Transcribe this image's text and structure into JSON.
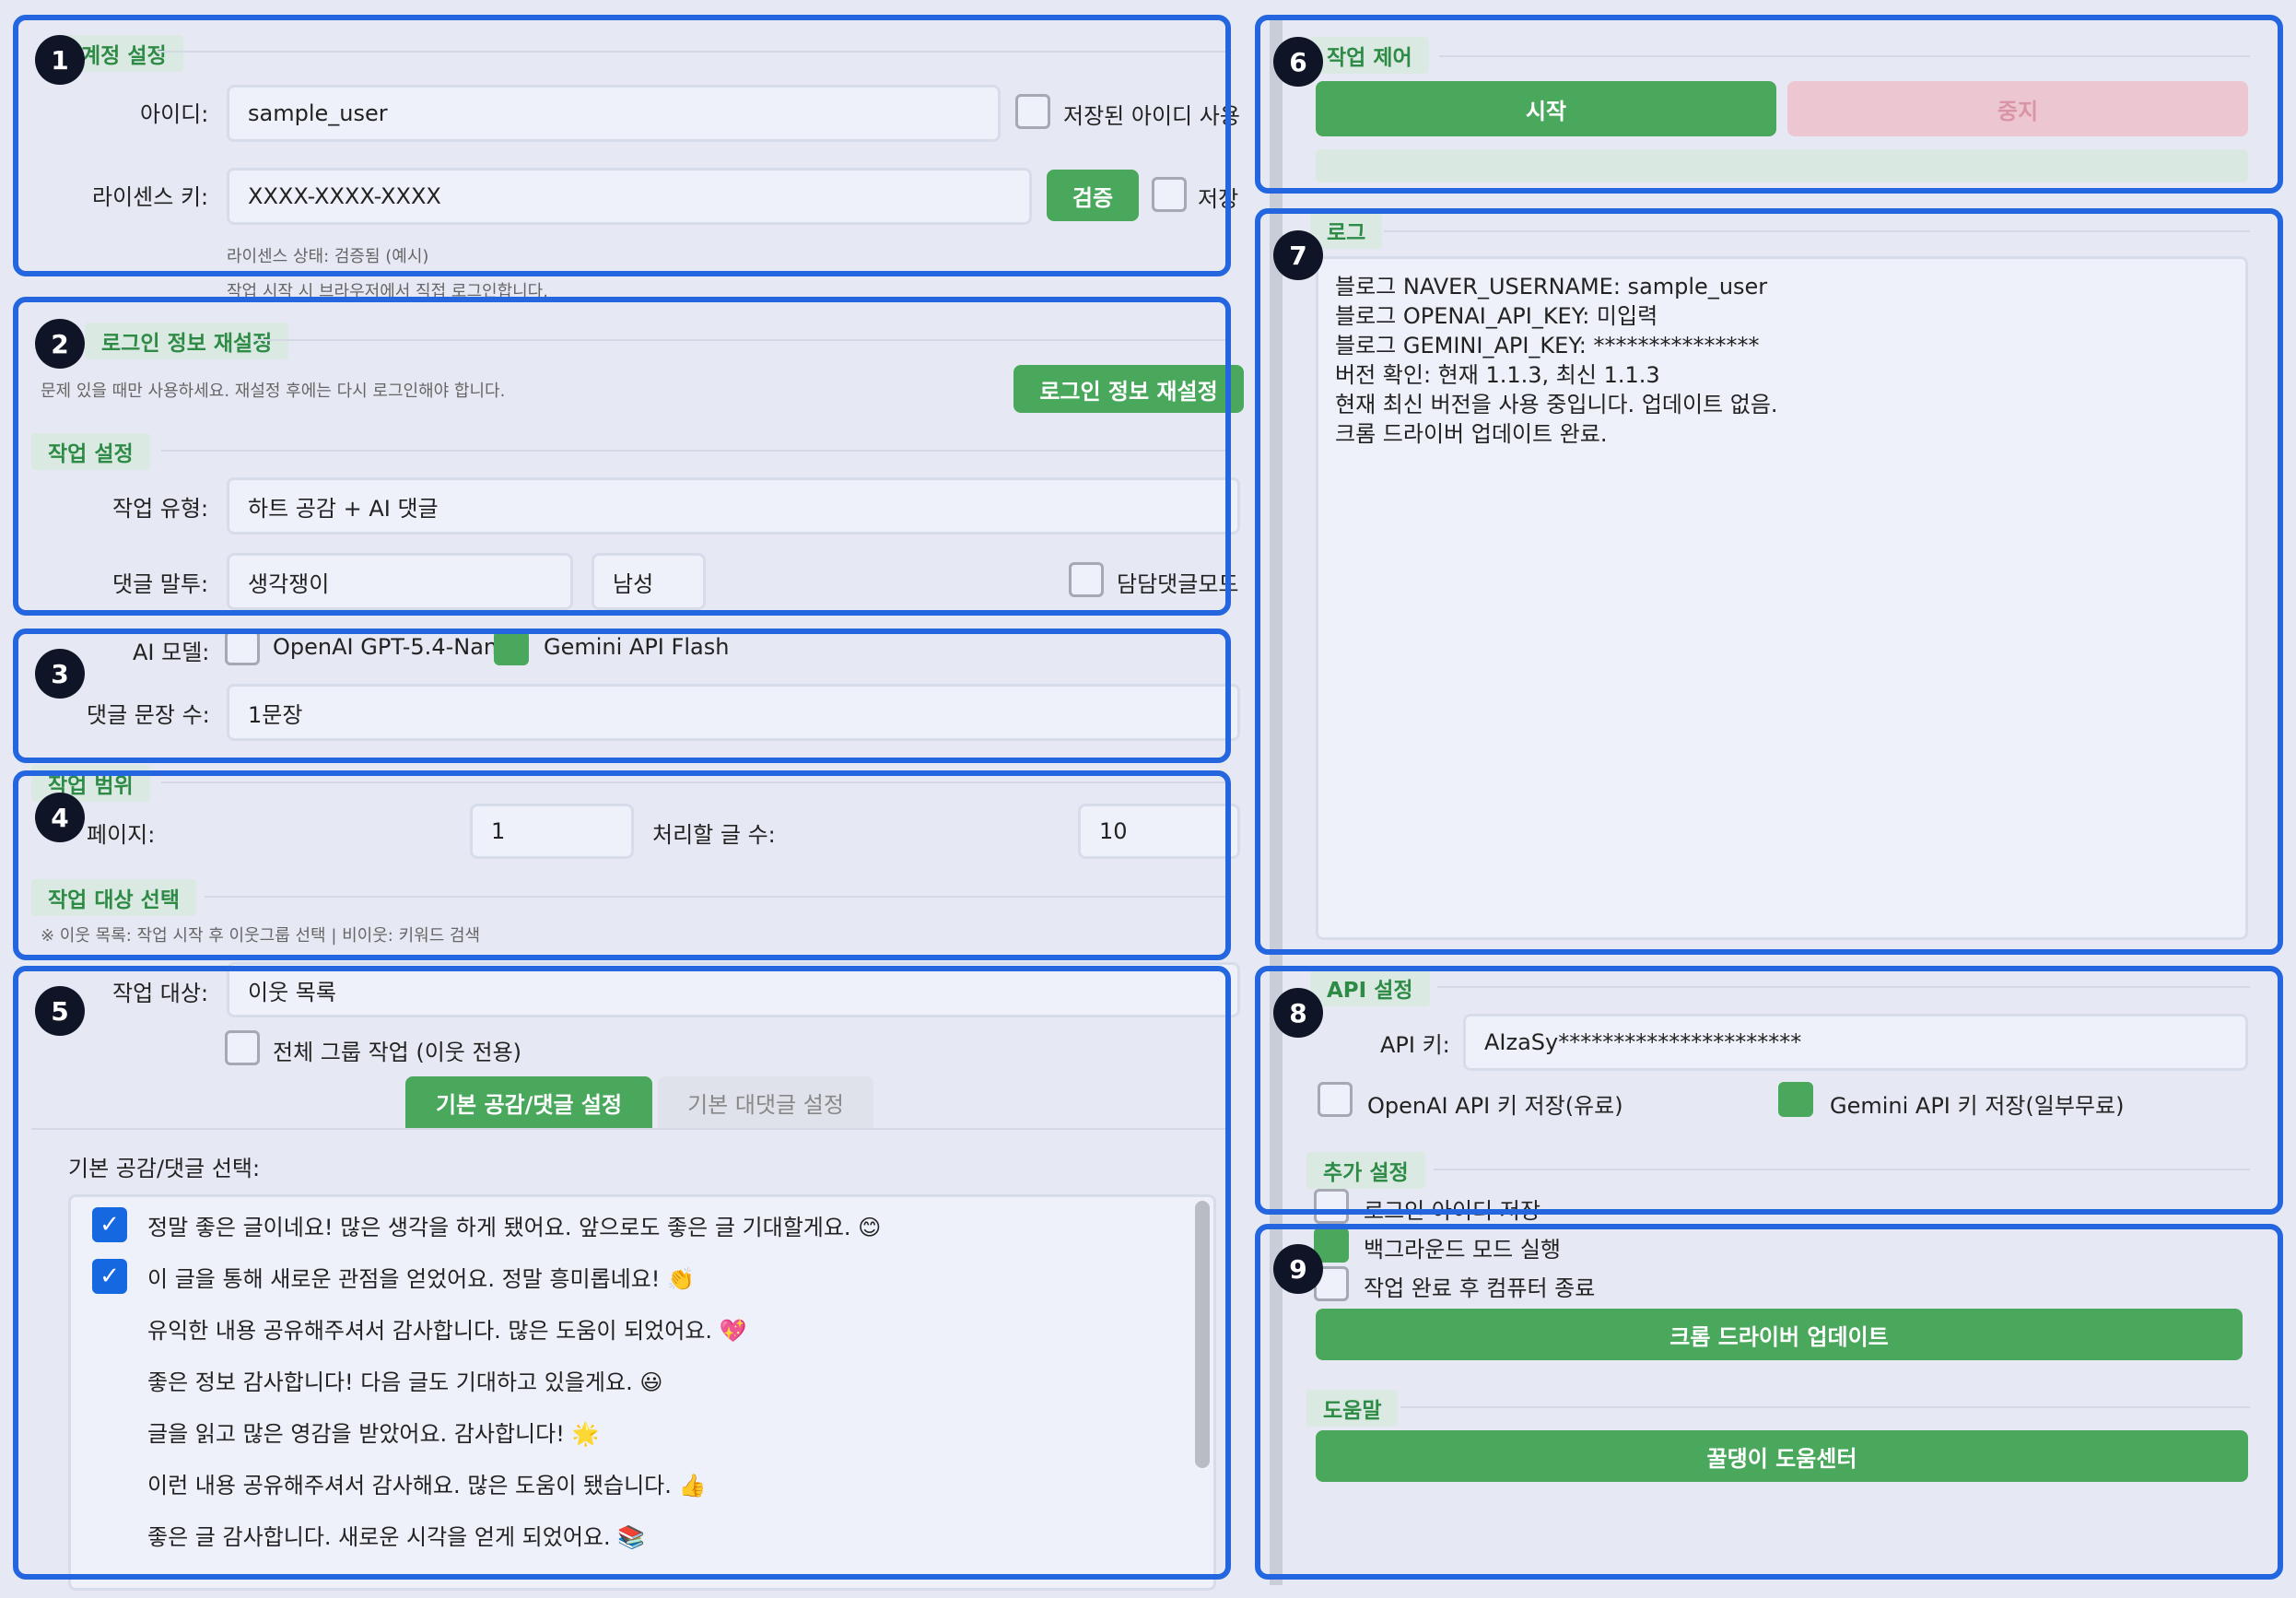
{
  "account": {
    "title": "계정 설정",
    "id_label": "아이디:",
    "id_value": "sample_user",
    "saved_id_label": "저장된 아이디 사용",
    "license_label": "라이센스 키:",
    "license_value": "XXXX-XXXX-XXXX",
    "verify_button": "검증",
    "save_label": "저장",
    "license_status": "라이센스 상태: 검증됨 (예시)",
    "login_note": "작업 시작 시 브라우저에서 직접 로그인합니다."
  },
  "login_reset": {
    "title": "로그인 정보 재설정",
    "note": "문제 있을 때만 사용하세요. 재설정 후에는 다시 로그인해야 합니다.",
    "button": "로그인 정보 재설정"
  },
  "task_settings": {
    "title": "작업 설정",
    "type_label": "작업 유형:",
    "type_value": "하트 공감 + AI 댓글",
    "tone_label": "댓글 말투:",
    "tone_value": "생각쟁이",
    "gender_value": "남성",
    "reply_mode_label": "담담댓글모드",
    "ai_model_label": "AI 모델:",
    "openai_label": "OpenAI GPT-5.4-Nano",
    "gemini_label": "Gemini API Flash",
    "sentence_label": "댓글 문장 수:",
    "sentence_value": "1문장"
  },
  "task_range": {
    "title": "작업 범위",
    "page_label": "페이지:",
    "page_value": "1",
    "count_label": "처리할 글 수:",
    "count_value": "10"
  },
  "target": {
    "title": "작업 대상 선택",
    "note": "※ 이웃 목록: 작업 시작 후 이웃그룹 선택 | 비이웃: 키워드 검색",
    "target_label": "작업 대상:",
    "target_value": "이웃 목록",
    "all_group_label": "전체 그룹 작업 (이웃 전용)"
  },
  "tabs": {
    "active": "기본 공감/댓글 설정",
    "inactive": "기본 대댓글 설정"
  },
  "comments": {
    "select_label": "기본 공감/댓글 선택:",
    "items": [
      {
        "text": "정말 좋은 글이네요! 많은 생각을 하게 됐어요. 앞으로도 좋은 글 기대할게요. 😊",
        "checked": true
      },
      {
        "text": "이 글을 통해 새로운 관점을 얻었어요. 정말 흥미롭네요! 👏",
        "checked": true
      },
      {
        "text": "유익한 내용 공유해주셔서 감사합니다. 많은 도움이 되었어요. 💖",
        "checked": false
      },
      {
        "text": "좋은 정보 감사합니다! 다음 글도 기대하고 있을게요. 😃",
        "checked": false
      },
      {
        "text": "글을 읽고 많은 영감을 받았어요. 감사합니다! 🌟",
        "checked": false
      },
      {
        "text": "이런 내용 공유해주셔서 감사해요. 많은 도움이 됐습니다. 👍",
        "checked": false
      },
      {
        "text": "좋은 글 감사합니다. 새로운 시각을 얻게 되었어요. 📚",
        "checked": false
      }
    ]
  },
  "control": {
    "title": "작업 제어",
    "start": "시작",
    "stop": "중지"
  },
  "log": {
    "title": "로그",
    "lines": [
      "블로그 NAVER_USERNAME: sample_user",
      "블로그 OPENAI_API_KEY: 미입력",
      "블로그 GEMINI_API_KEY: ***************",
      "버전 확인: 현재 1.1.3, 최신 1.1.3",
      "현재 최신 버전을 사용 중입니다. 업데이트 없음.",
      "크롬 드라이버 업데이트 완료."
    ]
  },
  "api": {
    "title": "API 설정",
    "key_label": "API 키:",
    "key_value": "AIzaSy**********************",
    "openai_save": "OpenAI API 키 저장(유료)",
    "gemini_save": "Gemini API 키 저장(일부무료)"
  },
  "extra": {
    "title": "추가 설정",
    "save_login_id": "로그인 아이디 저장",
    "background_mode": "백그라운드 모드 실행",
    "shutdown": "작업 완료 후 컴퓨터 종료",
    "driver_update": "크롬 드라이버 업데이트"
  },
  "help": {
    "title": "도움말",
    "center": "꿀댕이 도움센터"
  },
  "annotations": [
    "1",
    "2",
    "3",
    "4",
    "5",
    "6",
    "7",
    "8",
    "9"
  ],
  "colors": {
    "accent_green": "#4aa85d",
    "annotation_blue": "#2466e0",
    "disabled_pink": "#ecc7d2"
  }
}
